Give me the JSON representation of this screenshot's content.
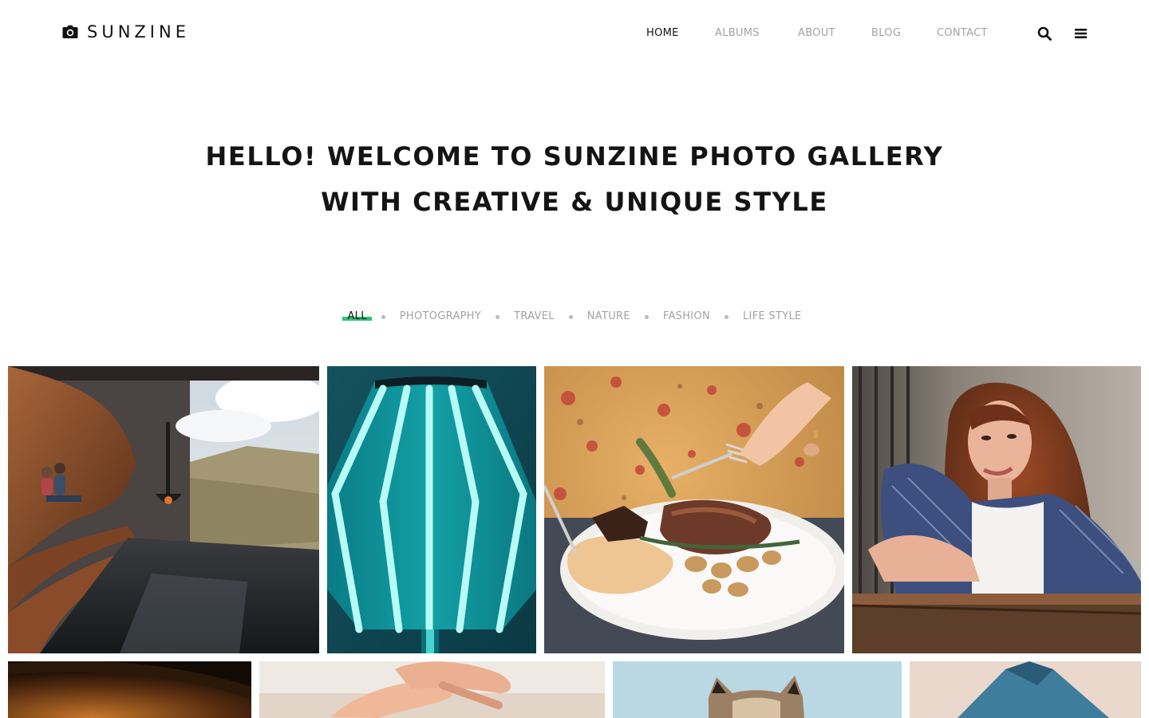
{
  "brand": {
    "name": "SUNZINE",
    "icon": "camera-icon"
  },
  "nav": {
    "items": [
      {
        "label": "HOME",
        "active": true
      },
      {
        "label": "ALBUMS",
        "active": false
      },
      {
        "label": "ABOUT",
        "active": false
      },
      {
        "label": "BLOG",
        "active": false
      },
      {
        "label": "CONTACT",
        "active": false
      }
    ],
    "search_icon": "search-icon",
    "menu_icon": "hamburger-menu-icon"
  },
  "hero": {
    "line1": "HELLO! WELCOME TO SUNZINE PHOTO GALLERY",
    "line2": "WITH CREATIVE & UNIQUE STYLE"
  },
  "filters": {
    "items": [
      {
        "label": "ALL",
        "active": true
      },
      {
        "label": "PHOTOGRAPHY",
        "active": false
      },
      {
        "label": "TRAVEL",
        "active": false
      },
      {
        "label": "NATURE",
        "active": false
      },
      {
        "label": "FASHION",
        "active": false
      },
      {
        "label": "LIFE STYLE",
        "active": false
      }
    ]
  },
  "gallery": {
    "photos": [
      {
        "subject": "couple in mountain cabin photo"
      },
      {
        "subject": "teal lamp photo"
      },
      {
        "subject": "steak dinner plate photo"
      },
      {
        "subject": "woman with red hair photo"
      },
      {
        "subject": "dark amber photo"
      },
      {
        "subject": "hands photo"
      },
      {
        "subject": "cat photo"
      },
      {
        "subject": "blue object photo"
      }
    ]
  },
  "colors": {
    "accent": "#2ec27e",
    "text": "#111111",
    "muted": "#a3a3a3"
  }
}
